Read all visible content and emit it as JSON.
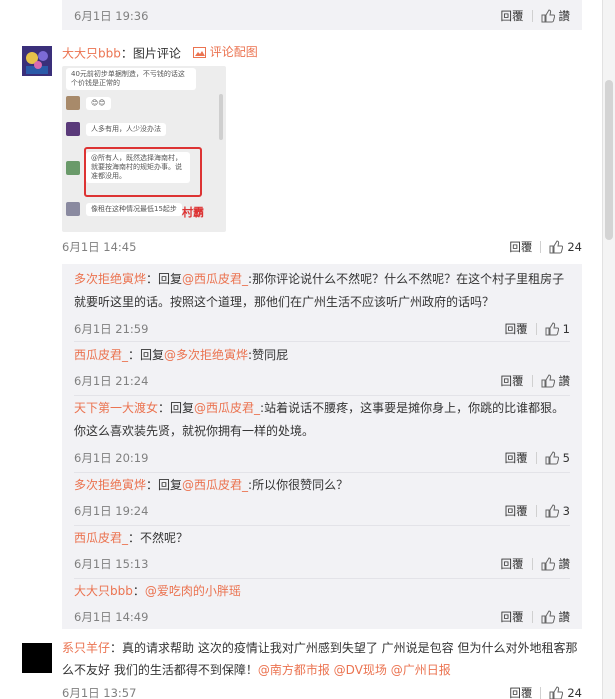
{
  "top": {
    "time": "6月1日 19:36",
    "reply": "回覆",
    "like": "讚"
  },
  "main_comment": {
    "user": "大大只bbb",
    "text": "：图片评论",
    "tag": "评论配图",
    "time": "6月1日 14:45",
    "reply": "回覆",
    "likes": "24",
    "image": {
      "lines": [
        "40元前初步单据制造，不亏钱的话这个价钱是正常的",
        "",
        "人多有用，人少没办法",
        "@所有人，既然选择海南村，就要按海南村的规矩办事。说准都没用。",
        "像租在这种情况最低15起步"
      ],
      "label": "村霸"
    }
  },
  "replies": [
    {
      "user": "多次拒绝寅烨",
      "prefix": "：回复",
      "target": "@西瓜皮君_",
      "text": ":那你评论说什么不然呢？什么不然呢？在这个村子里租房子就要听这里的话。按照这个道理，那他们在广州生活不应该听广州政府的话吗？",
      "time": "6月1日 21:59",
      "reply": "回覆",
      "like": "1"
    },
    {
      "user": "西瓜皮君_",
      "prefix": "：回复",
      "target": "@多次拒绝寅烨",
      "text": ":赞同屁",
      "time": "6月1日 21:24",
      "reply": "回覆",
      "like": "讚"
    },
    {
      "user": "天下第一大渡女",
      "prefix": "：回复",
      "target": "@西瓜皮君_",
      "text": ":站着说话不腰疼，这事要是摊你身上，你跳的比谁都狠。你这么喜欢装先贤，就祝你拥有一样的处境。",
      "time": "6月1日 20:19",
      "reply": "回覆",
      "like": "5"
    },
    {
      "user": "多次拒绝寅烨",
      "prefix": "：回复",
      "target": "@西瓜皮君_",
      "text": ":所以你很赞同么？",
      "time": "6月1日 19:24",
      "reply": "回覆",
      "like": "3"
    },
    {
      "user": "西瓜皮君_",
      "prefix": "",
      "target": "",
      "text": "：不然呢？",
      "time": "6月1日 15:13",
      "reply": "回覆",
      "like": "讚"
    },
    {
      "user": "大大只bbb",
      "prefix": "：",
      "target": "@爱吃肉的小胖瑶",
      "text": "",
      "time": "6月1日 14:49",
      "reply": "回覆",
      "like": "讚"
    }
  ],
  "bottom_comment": {
    "user": "系只羊仔",
    "text": "：真的请求帮助 这次的疫情让我对广州感到失望了 广州说是包容 但为什么对外地租客那么不友好 我们的生活都得不到保障！",
    "mentions": [
      "@南方都市报",
      "@DV现场",
      "@广州日报"
    ],
    "time": "6月1日 13:57",
    "reply": "回覆",
    "likes": "24"
  },
  "colors": {
    "accent": "#eb7350",
    "reply_bg": "#f2f2f5",
    "text": "#333333",
    "muted": "#808080"
  }
}
